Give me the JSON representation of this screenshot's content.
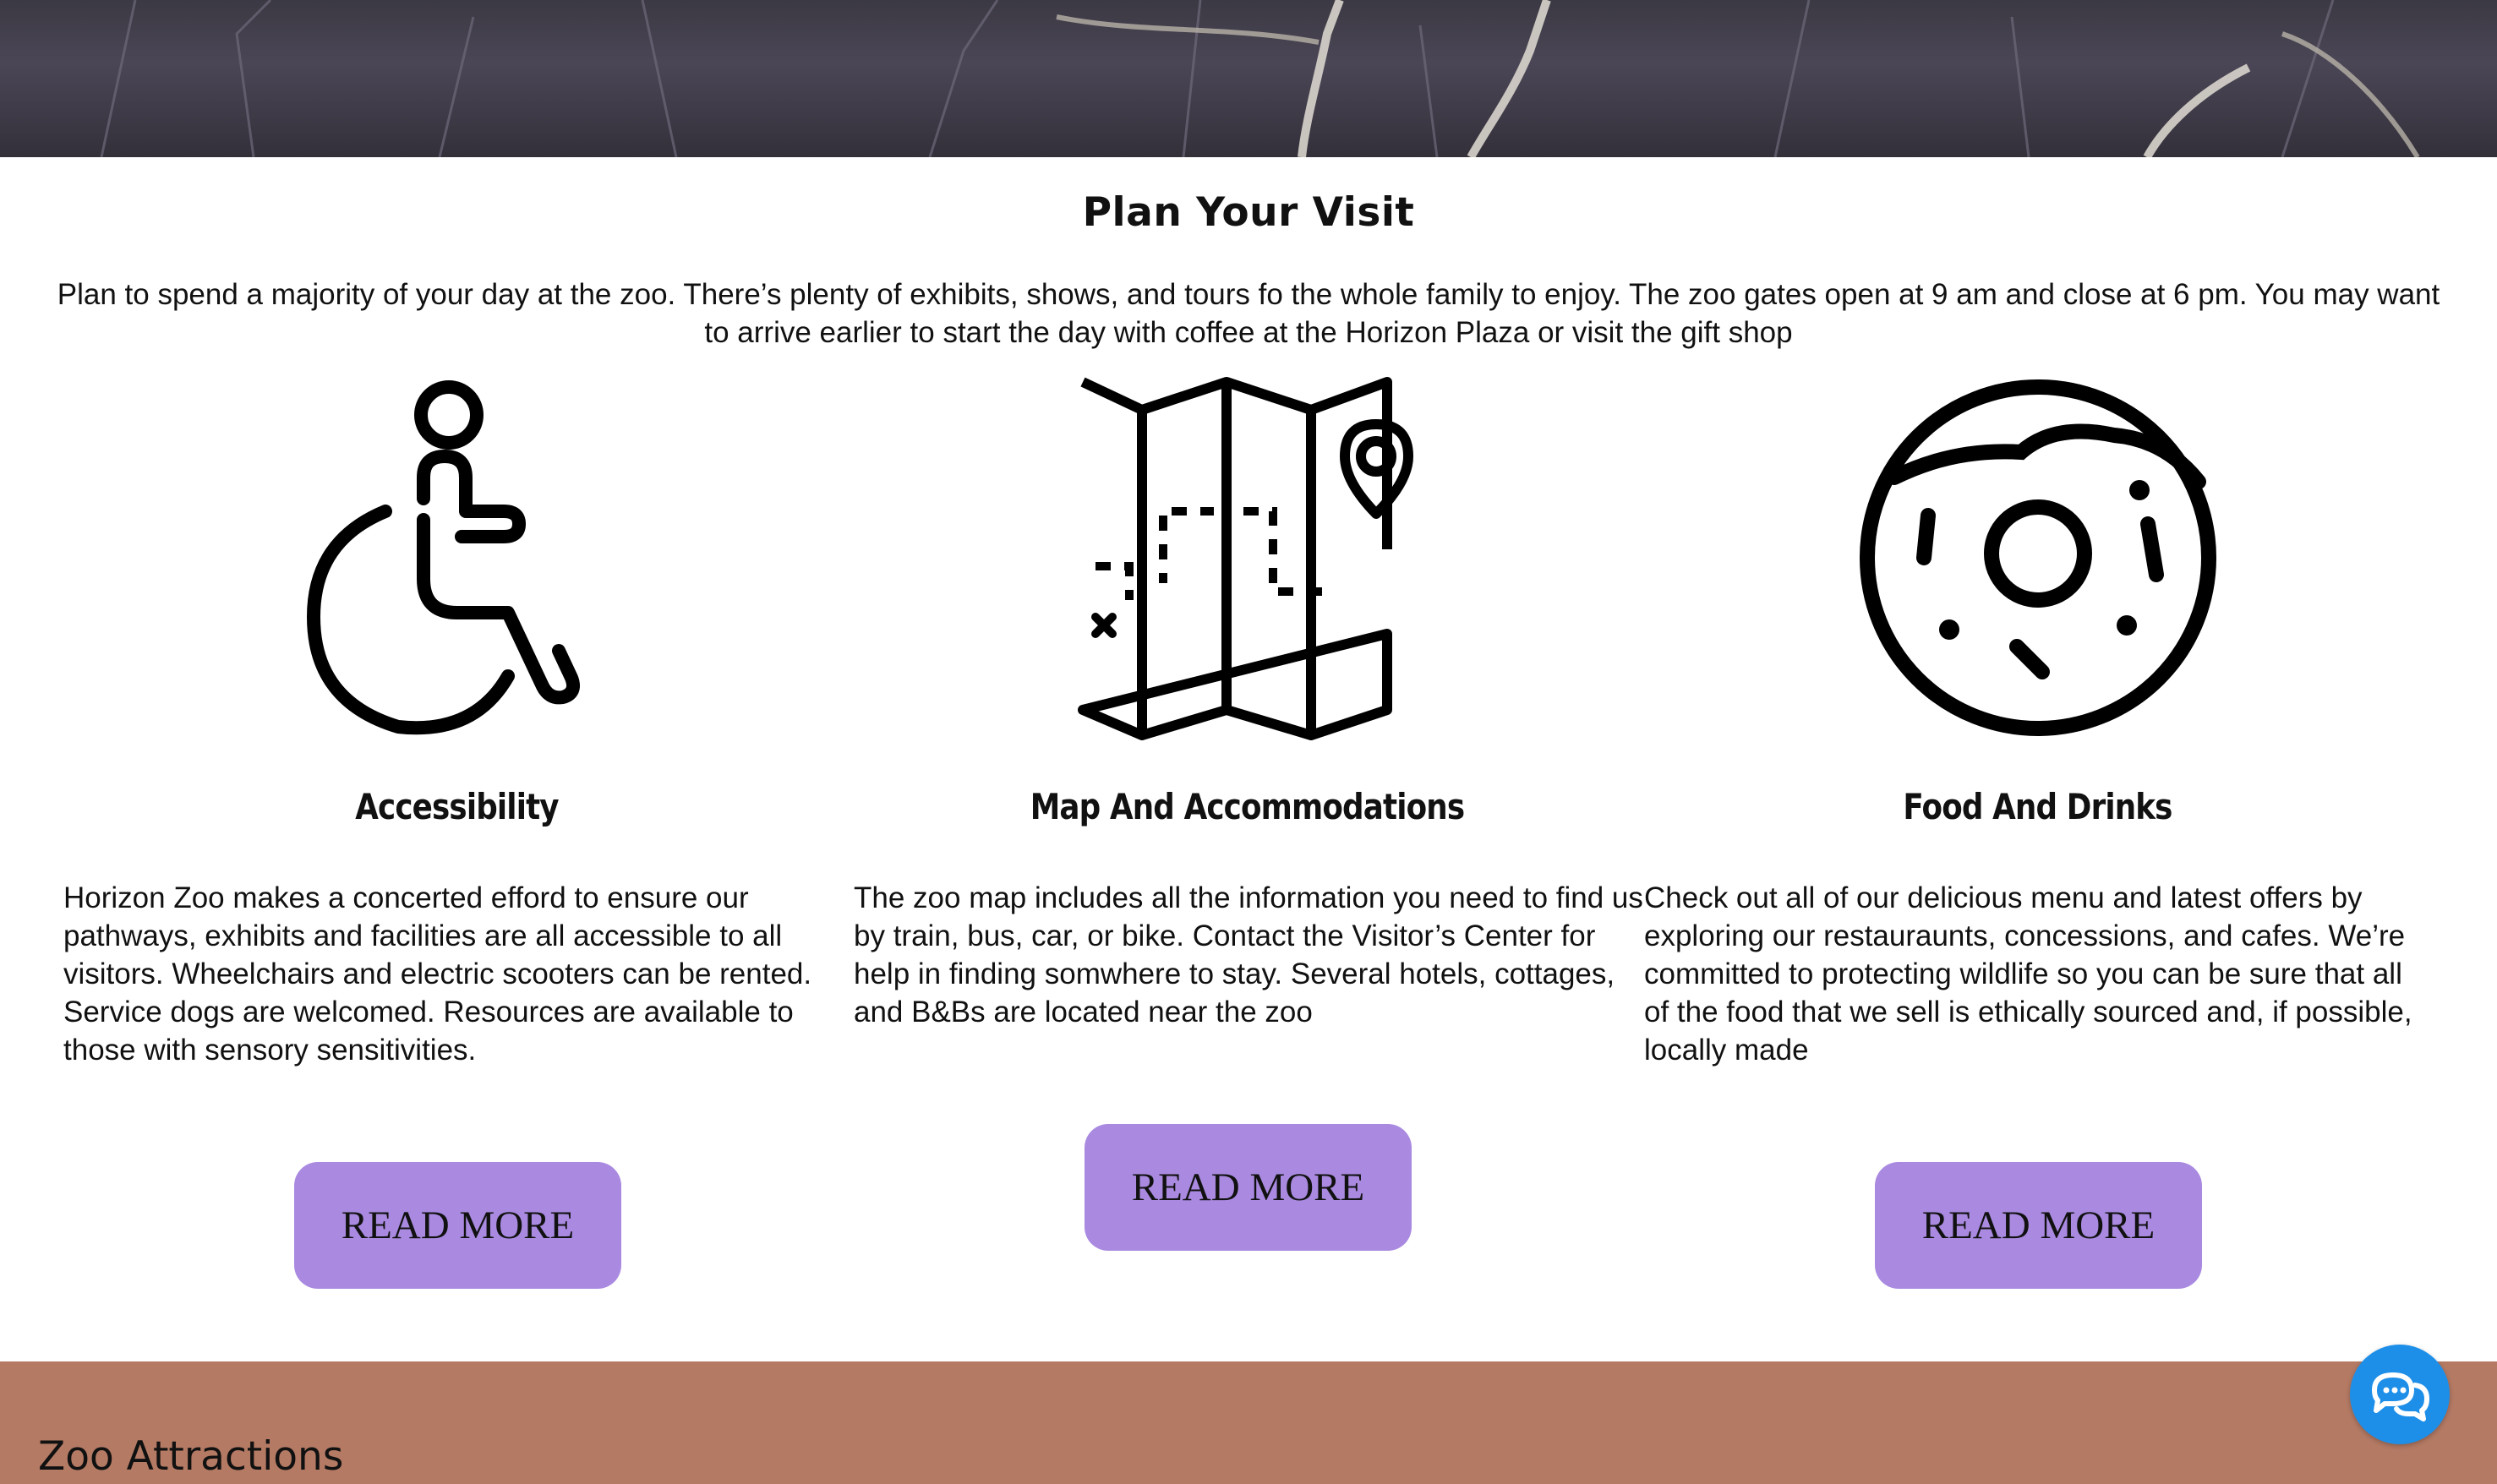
{
  "plan": {
    "title": "Plan Your Visit",
    "intro": "Plan to spend a majority of your day at the zoo. There’s plenty of exhibits, shows, and tours fo the whole family to enjoy. The zoo gates open at 9 am and close at 6 pm. You may want to arrive earlier to start the day with coffee at the Horizon Plaza or visit the gift shop"
  },
  "cards": [
    {
      "icon": "wheelchair-icon",
      "title": "Accessibility",
      "body": "Horizon Zoo makes a concerted efford to ensure our pathways, exhibits and facilities are all accessible to all visitors. Wheelchairs and electric scooters can be rented. Service dogs are welcomed. Resources are available to those with sensory sensitivities.",
      "button": "READ MORE"
    },
    {
      "icon": "map-icon",
      "title": "Map And Accommodations",
      "body": "The zoo map includes all the information you need to find us by train, bus, car, or bike. Contact the Visitor’s Center for help in finding somwhere to stay. Several hotels, cottages, and B&Bs are located near the zoo",
      "button": "READ MORE"
    },
    {
      "icon": "donut-icon",
      "title": "Food And Drinks",
      "body": "Check out all of our delicious menu and latest offers by exploring our restauraunts, concessions, and cafes. We’re committed to protecting wildlife so you can be sure that all of the food that we sell is ethically sourced and, if possible, locally made",
      "button": "READ MORE"
    }
  ],
  "attractions": {
    "title": "Zoo Attractions"
  },
  "chat": {
    "icon": "chat-icon"
  },
  "colors": {
    "button": "#a98ae0",
    "attractions_bg": "#b47a64",
    "chat": "#1e8fe8"
  }
}
